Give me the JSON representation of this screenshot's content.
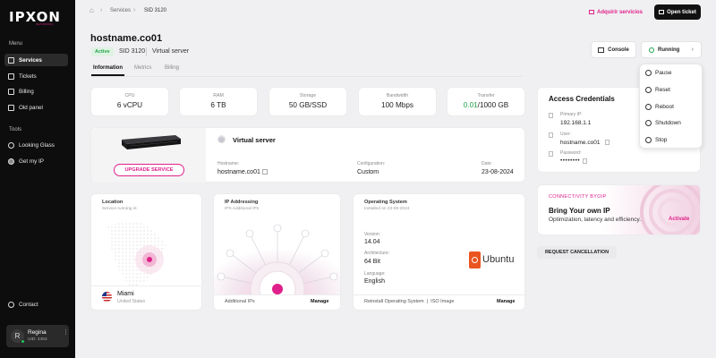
{
  "sidebar": {
    "logo": "IPXON",
    "logo_sub": "NETWORKS",
    "menu_label": "Menu",
    "tools_label": "Tools",
    "items": [
      {
        "label": "Services"
      },
      {
        "label": "Tickets"
      },
      {
        "label": "Billing"
      },
      {
        "label": "Old panel"
      }
    ],
    "tools": [
      {
        "label": "Looking Glass"
      },
      {
        "label": "Get my IP"
      }
    ],
    "contact": "Contact",
    "user": {
      "initial": "R",
      "name": "Regina",
      "uid": "UID: 3453"
    }
  },
  "breadcrumb": {
    "services": "Services",
    "current": "SID 3120"
  },
  "topbar": {
    "adquirir": "Adquirir servicios",
    "open_ticket": "Open ticket"
  },
  "header": {
    "hostname": "hostname.co01",
    "status": "Active",
    "sid": "SID 3120",
    "type": "Virtual server",
    "console": "Console",
    "running": "Running"
  },
  "tabs": [
    "Information",
    "Metrics",
    "Billing"
  ],
  "stats": [
    {
      "label": "CPU",
      "value": "6 vCPU"
    },
    {
      "label": "RAM",
      "value": "6 TB"
    },
    {
      "label": "Storage",
      "value": "50 GB/SSD"
    },
    {
      "label": "Bandwidth",
      "value": "100 Mbps"
    },
    {
      "label": "Transfer",
      "value_used": "0.01",
      "value_total": "/1000 GB"
    }
  ],
  "server": {
    "upgrade": "UPGRADE SERVICE",
    "title": "Virtual server",
    "hostname_label": "Hostname:",
    "hostname": "hostname.co01",
    "config_label": "Configuration:",
    "config": "Custom",
    "date_label": "Date:",
    "date": "23-08-2024"
  },
  "location": {
    "title": "Location",
    "sub": "Service running in:",
    "city": "Miami",
    "country": "United States"
  },
  "ip": {
    "title": "IP Addressing",
    "sub": "IPS Additional IPs",
    "footer": "Additional IPs",
    "manage": "Manage"
  },
  "os": {
    "title": "Operating System",
    "sub": "Installed on 23-08-2024",
    "version_label": "Version:",
    "version": "14.04",
    "arch_label": "Architecture:",
    "arch": "64 Bit",
    "lang_label": "Language:",
    "lang": "English",
    "logo_text": "Ubuntu",
    "footer": "Reinstall Operating System  |  ISO Image",
    "manage": "Manage"
  },
  "access": {
    "title": "Access Credentials",
    "primary_label": "Primary IP:",
    "primary": "192.168.1.1",
    "user_label": "User:",
    "user": "hostname.co01",
    "pass_label": "Password:",
    "pass": "••••••••"
  },
  "dropdown": [
    "Pause",
    "Reset",
    "Reboot",
    "Shutdown",
    "Stop"
  ],
  "byoip": {
    "tag": "CONNECTIVITY BYOIP",
    "title": "Bring Your own IP",
    "desc": "Optimization, latency and efficiency.",
    "activate": "Activate"
  },
  "cancel": "REQUEST CANCELLATION",
  "colors": {
    "accent": "#e0208a",
    "success": "#22a34a",
    "dark": "#0d0d0d"
  }
}
